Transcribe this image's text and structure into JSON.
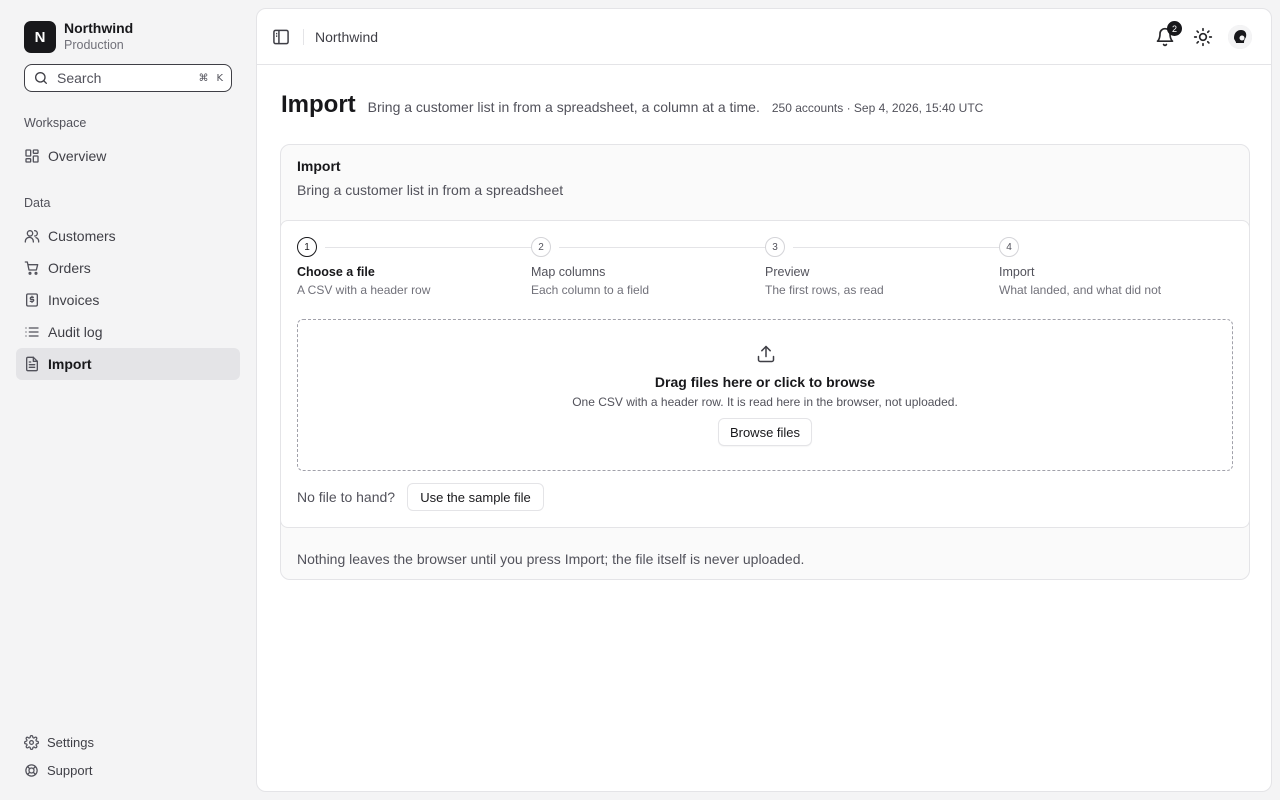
{
  "org": {
    "initial": "N",
    "name": "Northwind",
    "environment": "Production"
  },
  "search": {
    "placeholder": "Search",
    "shortcut_cmd": "⌘",
    "shortcut_key": "K"
  },
  "sidebar": {
    "workspace_label": "Workspace",
    "data_label": "Data",
    "items": [
      {
        "label": "Overview",
        "icon": "grid-icon"
      },
      {
        "label": "Customers",
        "icon": "users-icon"
      },
      {
        "label": "Orders",
        "icon": "cart-icon"
      },
      {
        "label": "Invoices",
        "icon": "receipt-icon"
      },
      {
        "label": "Audit log",
        "icon": "list-icon"
      },
      {
        "label": "Import",
        "icon": "file-icon",
        "active": true
      }
    ],
    "footer": [
      {
        "label": "Settings",
        "icon": "gear-icon"
      },
      {
        "label": "Support",
        "icon": "lifebuoy-icon"
      }
    ]
  },
  "topbar": {
    "breadcrumb": "Northwind",
    "notification_count": "2"
  },
  "page": {
    "title": "Import",
    "subtitle": "Bring a customer list in from a spreadsheet, a column at a time.",
    "meta": "250 accounts · Sep 4, 2026, 15:40 UTC"
  },
  "card": {
    "title": "Import",
    "description": "Bring a customer list in from a spreadsheet",
    "footer": "Nothing leaves the browser until you press Import; the file itself is never uploaded."
  },
  "steps": [
    {
      "number": "1",
      "title": "Choose a file",
      "subtitle": "A CSV with a header row",
      "active": true
    },
    {
      "number": "2",
      "title": "Map columns",
      "subtitle": "Each column to a field"
    },
    {
      "number": "3",
      "title": "Preview",
      "subtitle": "The first rows, as read"
    },
    {
      "number": "4",
      "title": "Import",
      "subtitle": "What landed, and what did not"
    }
  ],
  "dropzone": {
    "title": "Drag files here or click to browse",
    "subtitle": "One CSV with a header row. It is read here in the browser, not uploaded.",
    "browse_label": "Browse files"
  },
  "sample": {
    "prompt": "No file to hand?",
    "button_label": "Use the sample file"
  }
}
